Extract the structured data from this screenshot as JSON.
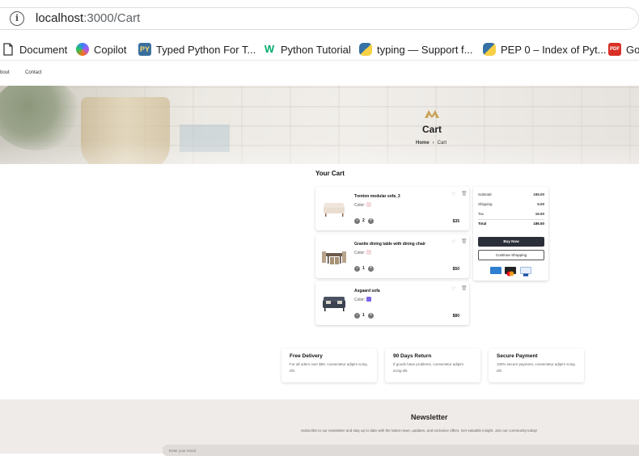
{
  "browser": {
    "url_host": "localhost",
    "url_path": ":3000/Cart",
    "bookmarks": [
      {
        "label": "Document",
        "icon": "document-icon"
      },
      {
        "label": "Copilot",
        "icon": "copilot-icon"
      },
      {
        "label": "Typed Python For T...",
        "icon": "py-icon",
        "badge": "PY"
      },
      {
        "label": "Python Tutorial",
        "icon": "w3-icon",
        "badge": "W"
      },
      {
        "label": "typing — Support f...",
        "icon": "python-icon"
      },
      {
        "label": "PEP 0 – Index of Pyt...",
        "icon": "python-icon"
      },
      {
        "label": "Go",
        "icon": "pdf-icon",
        "badge": "PDF"
      }
    ]
  },
  "nav": {
    "links": [
      "bout",
      "Contact"
    ]
  },
  "hero": {
    "title": "Cart",
    "breadcrumb_home": "Home",
    "breadcrumb_sep": "›",
    "breadcrumb_current": "Cart"
  },
  "cart": {
    "title": "Your Cart",
    "color_label": "Color:",
    "items": [
      {
        "name": "Trenton modular sofa_3",
        "qty": "2",
        "price": "$35",
        "swatch": "#f4d9dd"
      },
      {
        "name": "Granite dining table with dining chair",
        "qty": "1",
        "price": "$50",
        "swatch": "#f4d9dd"
      },
      {
        "name": "Asgaard sofa",
        "qty": "1",
        "price": "$80",
        "swatch": "#7c63e6"
      }
    ]
  },
  "summary": {
    "rows": [
      {
        "label": "Subtotal",
        "value": "165.00"
      },
      {
        "label": "Shipping",
        "value": "5.00"
      },
      {
        "label": "Tax",
        "value": "16.50"
      },
      {
        "label": "Total",
        "value": "186.50"
      }
    ],
    "buy_label": "Buy Now",
    "continue_label": "Continue Shopping",
    "payments": [
      "amex-icon",
      "mastercard-icon",
      "card-icon"
    ]
  },
  "features": [
    {
      "title": "Free Delivery",
      "desc": "For all oders over $50, consectetur adipim scing elit."
    },
    {
      "title": "90 Days Return",
      "desc": "If goods have problems, consectetur adipim scing elit."
    },
    {
      "title": "Secure Payment",
      "desc": "100% secure payment, consectetur adipim scing elit."
    }
  ],
  "newsletter": {
    "title": "Newsletter",
    "subtitle": "Subscribe to our newsletter and stay up to date with the latest news, updates, and exclusive offers. Get valuable insight. Join our community today!",
    "placeholder": "Enter your email"
  }
}
